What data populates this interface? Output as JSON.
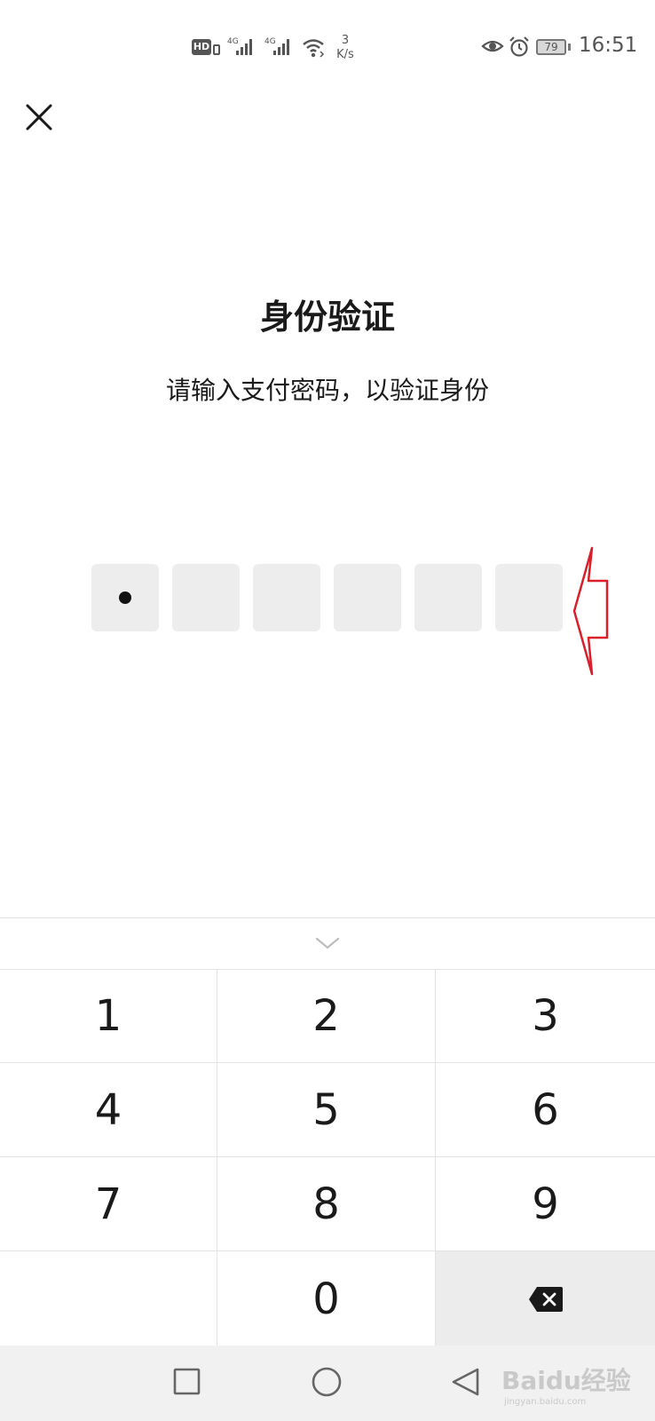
{
  "status_bar": {
    "hd_label": "HD",
    "network_type_1": "4G",
    "network_type_2": "4G",
    "net_speed_value": "3",
    "net_speed_unit": "K/s",
    "battery_level": "79",
    "time": "16:51",
    "icons": [
      "hd-icon",
      "signal-icon",
      "signal-icon",
      "wifi-icon",
      "eye-icon",
      "alarm-icon",
      "battery-icon"
    ]
  },
  "header": {
    "close_icon": "close-icon"
  },
  "main": {
    "title": "身份验证",
    "subtitle": "请输入支付密码，以验证身份",
    "pin": {
      "length": 6,
      "filled": 1
    }
  },
  "keypad": {
    "collapse_icon": "chevron-down-icon",
    "keys": [
      "1",
      "2",
      "3",
      "4",
      "5",
      "6",
      "7",
      "8",
      "9",
      "",
      "0",
      "delete"
    ],
    "delete_icon": "backspace-icon"
  },
  "nav_bar": {
    "buttons": [
      "recent-apps",
      "home",
      "back"
    ]
  },
  "watermark": {
    "text": "Baidu经验",
    "subtext": "jingyan.baidu.com"
  },
  "colors": {
    "background": "#ffffff",
    "pin_box": "#ededed",
    "annotation_arrow": "#d9202a",
    "nav_bar": "#f1f1f1",
    "delete_key": "#ececec"
  }
}
